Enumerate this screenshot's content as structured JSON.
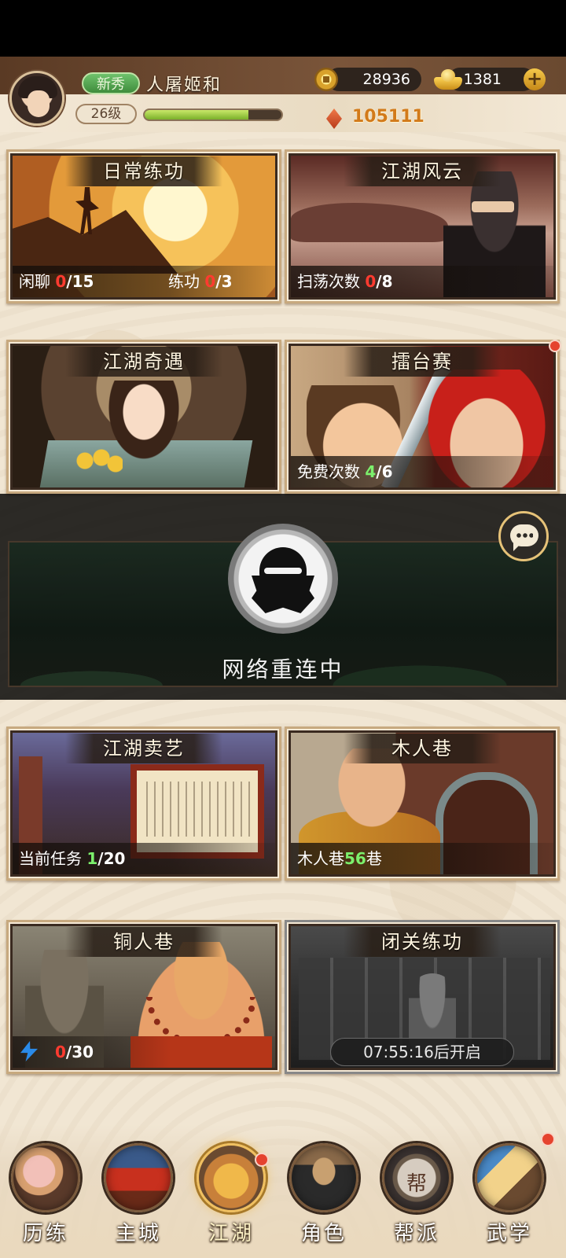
{
  "player": {
    "rank": "新秀",
    "name": "人屠姬和",
    "level": "26级",
    "xp_fraction": 0.76,
    "power": "105111"
  },
  "currency": {
    "coins": "28936",
    "ingots": "1381"
  },
  "cards": {
    "daily": {
      "title": "日常练功",
      "chat_label": "闲聊",
      "chat_done": "0",
      "chat_total": "/15",
      "practice_label": "练功",
      "practice_done": "0",
      "practice_total": "/3"
    },
    "jianghu_fengyun": {
      "title": "江湖风云",
      "sweep_label": "扫荡次数",
      "sweep_done": "0",
      "sweep_total": "/8"
    },
    "jianghu_qiyu": {
      "title": "江湖奇遇"
    },
    "arena": {
      "title": "擂台赛",
      "free_label": "免费次数",
      "free_done": "4",
      "free_total": "/6"
    },
    "jianghu_maiyi": {
      "title": "江湖卖艺",
      "task_label": "当前任务",
      "task_done": "1",
      "task_total": "/20"
    },
    "muren": {
      "title": "木人巷",
      "label": "木人巷",
      "value": "56",
      "suffix": "巷"
    },
    "tongren": {
      "title": "铜人巷",
      "energy_done": "0",
      "energy_total": "/30"
    },
    "biguan": {
      "title": "闭关练功",
      "timer": "07:55:16后开启"
    }
  },
  "overlay": {
    "reconnect_text": "网络重连中"
  },
  "nav": {
    "items": [
      {
        "label": "历练"
      },
      {
        "label": "主城"
      },
      {
        "label": "江湖"
      },
      {
        "label": "角色"
      },
      {
        "label": "帮派",
        "glyph": "帮"
      },
      {
        "label": "武学"
      }
    ],
    "active": "江湖"
  },
  "colors": {
    "accent_red": "#ff3b30",
    "accent_green": "#7cf06c",
    "power_orange": "#d27a1a",
    "badge_green": "#4fa34c"
  }
}
